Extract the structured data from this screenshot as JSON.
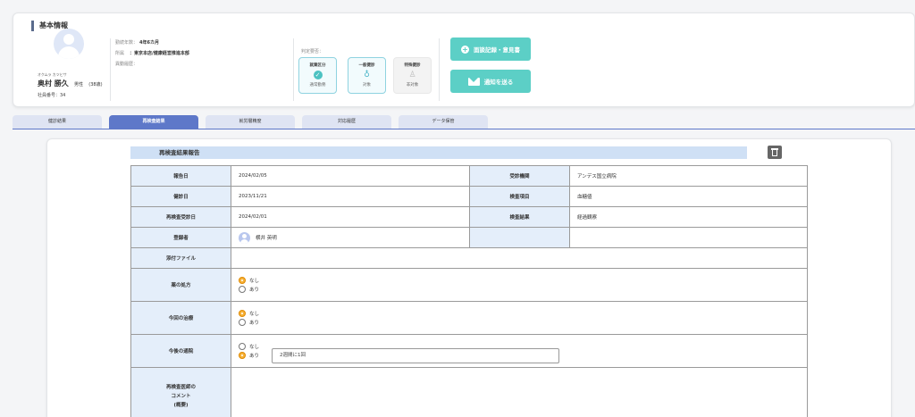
{
  "basic_info": {
    "title": "基本情報",
    "kana": "オクムラ カツヒサ",
    "name": "奥村 勝久",
    "gender": "男性",
    "age": "(38歳)",
    "employee_no": "社員番号：34",
    "tenure_label": "勤続年数：",
    "tenure_value": "4年6カ月",
    "dept_label": "所属",
    "dept_value": "：東京本店/健康経営推進本部",
    "leave_label": "異動履歴："
  },
  "judgement": {
    "label": "判定要否：",
    "boxes": [
      {
        "title": "就業区分",
        "status": "通常勤務"
      },
      {
        "title": "一般健診",
        "status": "対象"
      },
      {
        "title": "特殊健診",
        "status": "非対象"
      }
    ]
  },
  "actions": {
    "interview_label": "面談記録・意見書",
    "notify_label": "通知を送る"
  },
  "tabs": [
    "健診結果",
    "再検査結果",
    "就労層精度",
    "対応履歴",
    "データ保管"
  ],
  "report": {
    "section_title": "再検査結果報告",
    "report_date_label": "報告日",
    "report_date": "2024/02/05",
    "institution_label": "受診機関",
    "institution": "アンデス国立病院",
    "checkup_date_label": "健診日",
    "checkup_date": "2023/11/21",
    "exam_item_label": "検査項目",
    "exam_item": "血糖値",
    "recheck_date_label": "再検査受診日",
    "recheck_date": "2024/02/01",
    "exam_result_label": "検査結果",
    "exam_result": "経過観察",
    "registrant_label": "登録者",
    "registrant": "横井 英明",
    "attachment_label": "添付ファイル",
    "medicine_label": "薬の処方",
    "treatment_label": "今回の治療",
    "visit_label": "今後の通院",
    "opt_none": "なし",
    "opt_yes": "あり",
    "visit_freq": "2週間に1回",
    "comment_label_1": "再検査医師の",
    "comment_label_2": "コメント",
    "comment_label_3": "(概要)"
  }
}
